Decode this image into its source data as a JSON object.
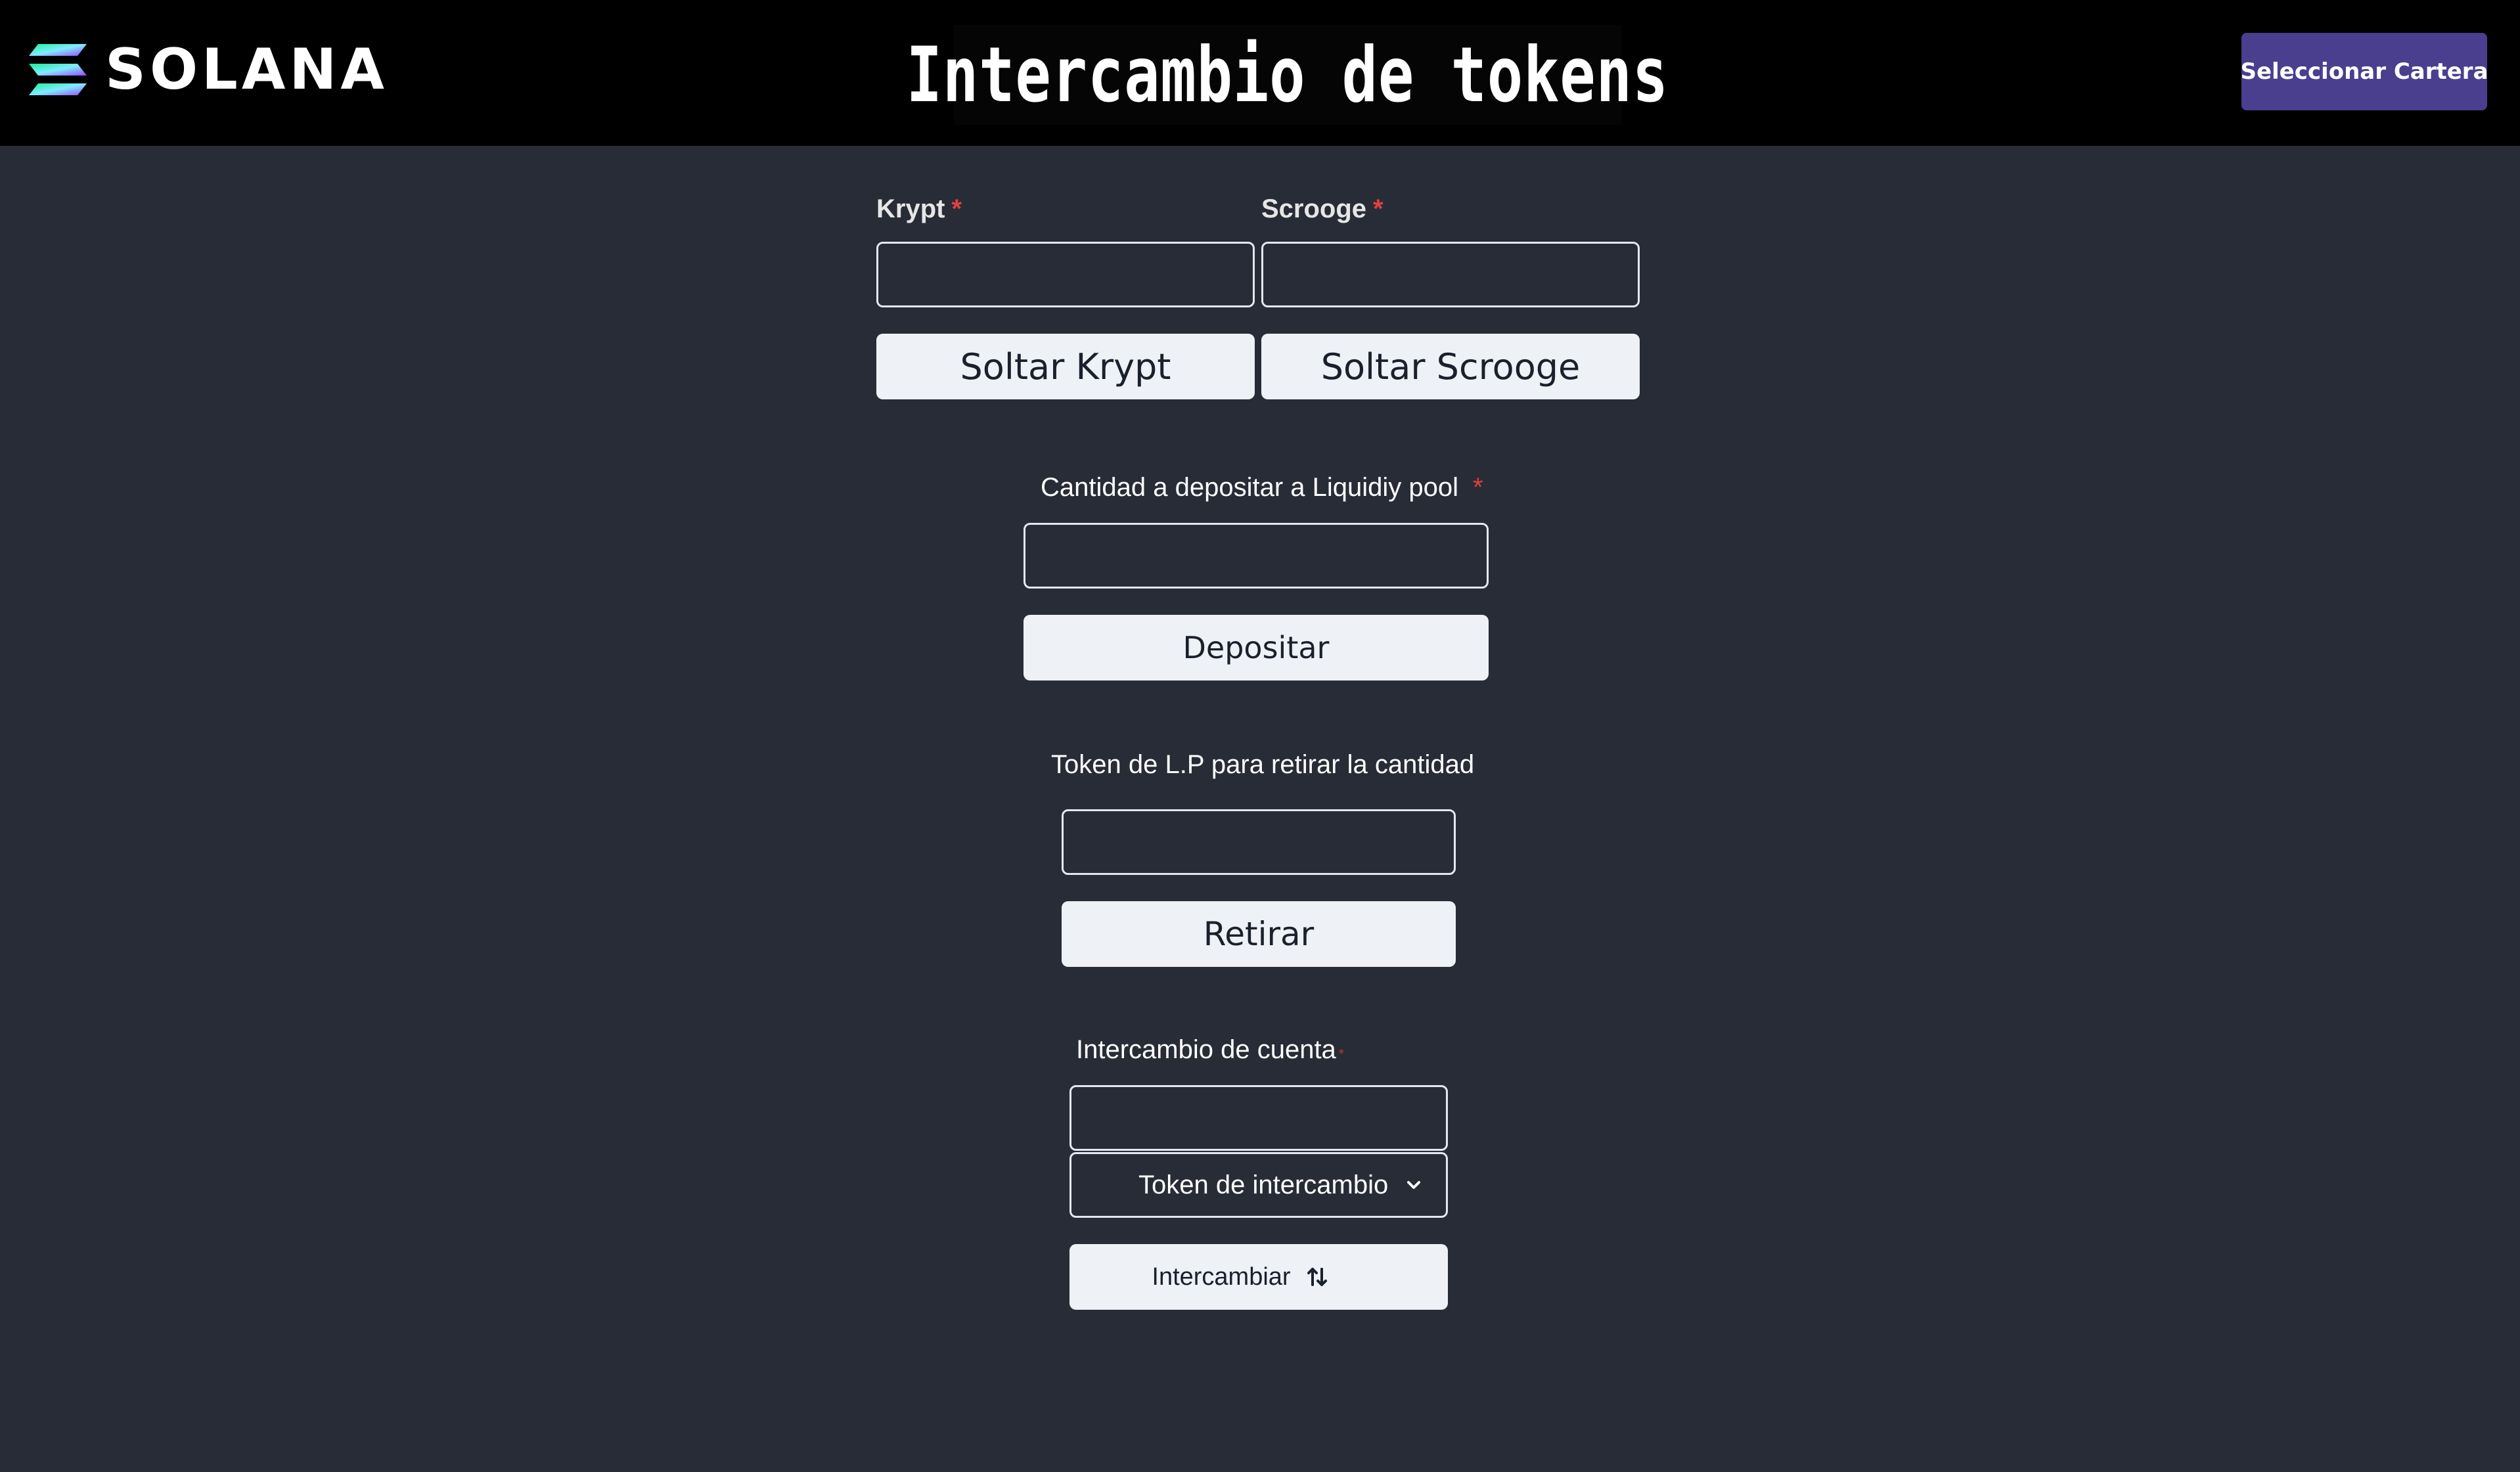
{
  "header": {
    "logo_text": "SOLANA",
    "title": "Intercambio de tokens",
    "wallet_button": "Seleccionar Cartera",
    "colors": {
      "background": "#000000",
      "wallet_button_bg": "#4a3f8e",
      "logo_gradient": [
        "#9945ff",
        "#14f195"
      ]
    }
  },
  "faucet": {
    "krypt_label": "Krypt",
    "scrooge_label": "Scrooge",
    "required_mark": "*",
    "krypt_value": "",
    "scrooge_value": "",
    "krypt_button": "Soltar Krypt",
    "scrooge_button": "Soltar Scrooge"
  },
  "deposit": {
    "label": "Cantidad a depositar a  Liquidiy pool",
    "required_mark": "*",
    "value": "",
    "button": "Depositar"
  },
  "withdraw": {
    "label": "Token de L.P para retirar la cantidad",
    "value": "",
    "button": "Retirar"
  },
  "swap": {
    "label": "Intercambio de cuenta",
    "required_mark": "*",
    "value": "",
    "select_placeholder": "Token de intercambio",
    "button": "Intercambiar",
    "icons": {
      "select": "chevron-down-icon",
      "button": "swap-arrows-icon"
    }
  },
  "colors": {
    "page_background": "#282c36",
    "required": "#e53e3e",
    "button_bg": "#eef1f5"
  }
}
